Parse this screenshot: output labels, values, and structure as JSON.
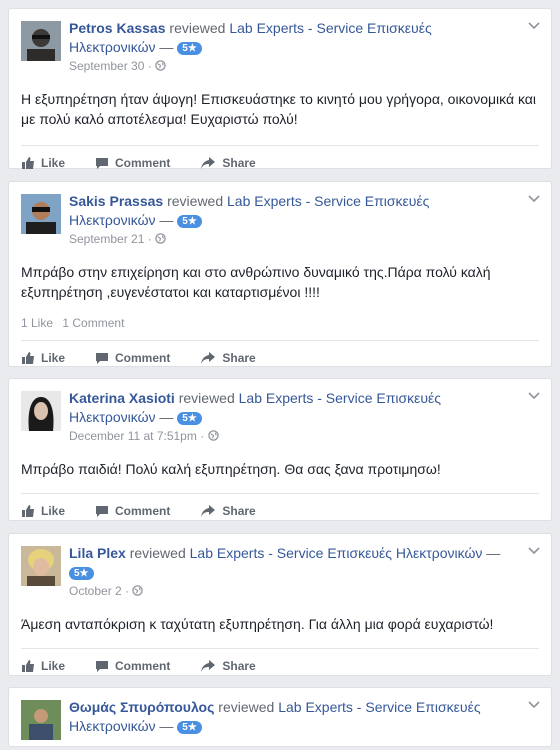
{
  "actions": {
    "like": "Like",
    "comment": "Comment",
    "share": "Share"
  },
  "common": {
    "reviewed": "reviewed",
    "page_name": "Lab Experts - Service Επισκευές Ηλεκτρονικών",
    "dash": "—",
    "rating": "5★",
    "dot": "·"
  },
  "reviews": [
    {
      "author": "Petros Kassas",
      "date": "September 30",
      "text": "Η εξυπηρέτηση ήταν άψογη! Επισκευάστηκε το κινητό μου γρήγορα, οικονομικά και με πολύ καλό αποτέλεσμα! Ευχαριστώ πολύ!",
      "likes": "",
      "comments": ""
    },
    {
      "author": "Sakis Prassas",
      "date": "September 21",
      "text": "Μπράβο στην επιχείρηση και στο ανθρώπινο δυναμικό της.Πάρα πολύ καλή εξυπηρέτηση ,ευγενέστατοι και καταρτισμένοι !!!!",
      "likes": "1 Like",
      "comments": "1 Comment"
    },
    {
      "author": "Katerina Xasioti",
      "date": "December 11 at 7:51pm",
      "text": "Μπράβο παιδιά! Πολύ καλή εξυπηρέτηση. Θα σας ξανα προτιμησω!",
      "likes": "",
      "comments": ""
    },
    {
      "author": "Lila Plex",
      "date": "October 2",
      "text": "Άμεση ανταπόκριση κ ταχύτατη εξυπηρέτηση. Για άλλη μια φορά ευχαριστώ!",
      "likes": "",
      "comments": ""
    },
    {
      "author": "Θωμάς Σπυρόπουλος",
      "date": "",
      "text": "",
      "likes": "",
      "comments": ""
    }
  ]
}
